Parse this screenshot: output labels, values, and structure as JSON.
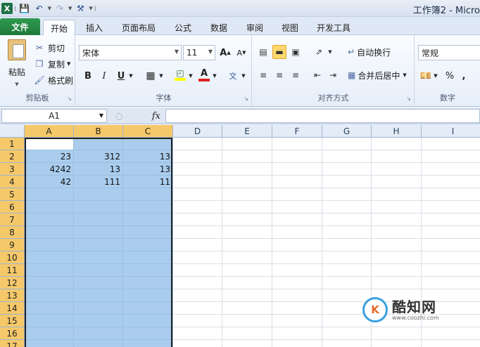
{
  "window_title": "工作簿2 - Micro",
  "qat": {
    "undo_icon": "undo-icon",
    "redo_icon": "redo-icon"
  },
  "tabs": [
    "文件",
    "开始",
    "插入",
    "页面布局",
    "公式",
    "数据",
    "审阅",
    "视图",
    "开发工具"
  ],
  "active_tab": "开始",
  "clipboard": {
    "paste": "粘贴",
    "cut": "剪切",
    "copy": "复制",
    "format_painter": "格式刷",
    "group_label": "剪贴板"
  },
  "font": {
    "name": "宋体",
    "size": "11",
    "bold": "B",
    "italic": "I",
    "underline": "U",
    "grow": "A",
    "shrink": "A",
    "group_label": "字体",
    "font_color": "#e02020",
    "fill_color": "#ffff00"
  },
  "alignment": {
    "wrap_text": "自动换行",
    "merge_center": "合并后居中",
    "group_label": "对齐方式"
  },
  "number": {
    "format": "常规",
    "percent": "%",
    "comma": ",",
    "group_label": "数字"
  },
  "formula_bar": {
    "name_box": "A1",
    "fx": "fx",
    "value": ""
  },
  "columns": [
    "A",
    "B",
    "C",
    "D",
    "E",
    "F",
    "G",
    "H",
    "I"
  ],
  "rows": [
    "1",
    "2",
    "3",
    "4",
    "5",
    "6",
    "7",
    "8",
    "9",
    "10",
    "11",
    "12",
    "13",
    "14",
    "15",
    "16",
    "17"
  ],
  "cells": {
    "A2": "23",
    "B2": "312",
    "C2": "13",
    "A3": "4242",
    "B3": "13",
    "C3": "13",
    "A4": "42",
    "B4": "111",
    "C4": "11"
  },
  "selection": {
    "columns": [
      "A",
      "B",
      "C"
    ],
    "active_cell": "A1",
    "highlight_color": "#aacdee"
  },
  "watermark": {
    "name": "酷知网",
    "url": "www.coozhi.com",
    "logo_text": "K"
  }
}
